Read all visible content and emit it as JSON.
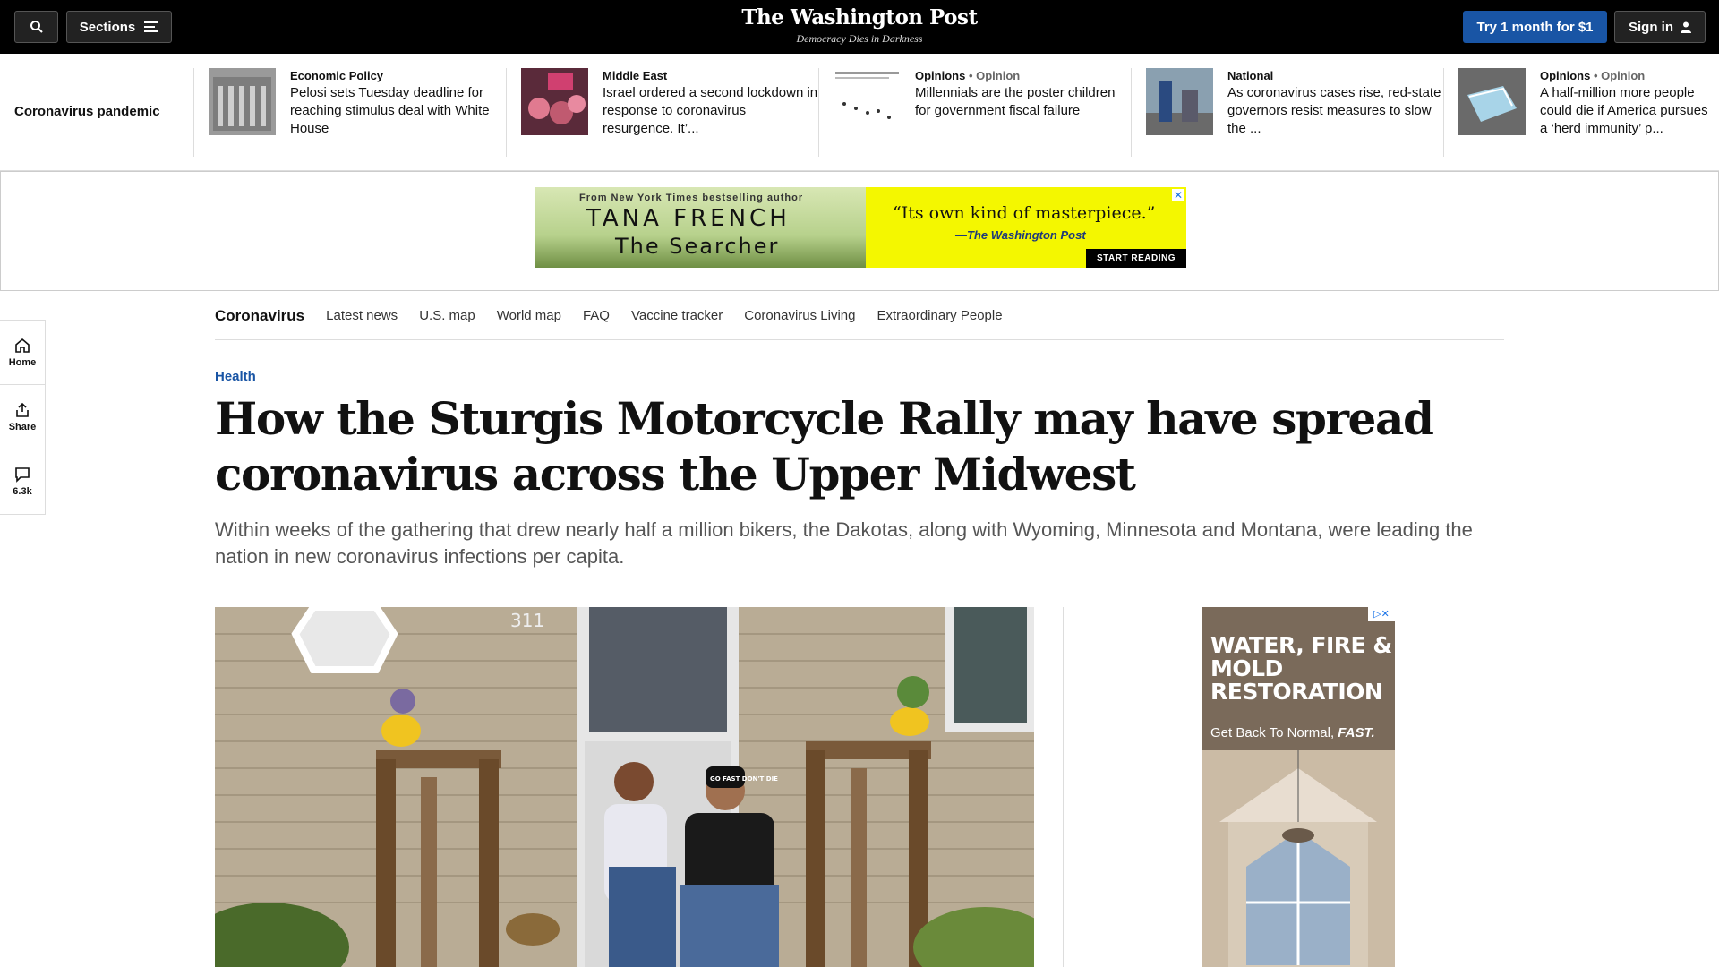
{
  "topbar": {
    "sections_label": "Sections",
    "logo": "The Washington Post",
    "tagline": "Democracy Dies in Darkness",
    "try_label": "Try 1 month for $1",
    "signin_label": "Sign in"
  },
  "strip": {
    "label": "Coronavirus pandemic",
    "items": [
      {
        "kicker": "Economic Policy",
        "opinion": "",
        "headline": "Pelosi sets Tuesday deadline for reaching stimulus deal with White House"
      },
      {
        "kicker": "Middle East",
        "opinion": "",
        "headline": "Israel ordered a second lockdown in response to coronavirus resurgence. It’..."
      },
      {
        "kicker": "Opinions",
        "opinion": "• Opinion",
        "headline": "Millennials are the poster children for government fiscal failure"
      },
      {
        "kicker": "National",
        "opinion": "",
        "headline": "As coronavirus cases rise, red-state governors resist measures to slow the ..."
      },
      {
        "kicker": "Opinions",
        "opinion": "• Opinion",
        "headline": "A half-million more people could die if America pursues a ‘herd immunity’ p..."
      }
    ]
  },
  "banner_ad": {
    "from": "From New York Times bestselling author",
    "author": "TANA FRENCH",
    "book": "The Searcher",
    "quote": "“Its own kind of masterpiece.”",
    "source": "—The Washington Post",
    "cta": "START READING"
  },
  "subnav": {
    "main": "Coronavirus",
    "links": [
      "Latest news",
      "U.S. map",
      "World map",
      "FAQ",
      "Vaccine tracker",
      "Coronavirus Living",
      "Extraordinary People"
    ]
  },
  "rail": {
    "home": "Home",
    "share": "Share",
    "comments": "6.3k"
  },
  "article": {
    "section": "Health",
    "headline": "How the Sturgis Motorcycle Rally may have spread coronavirus across the Upper Midwest",
    "dek": "Within weeks of the gathering that drew nearly half a million bikers, the Dakotas, along with Wyoming, Minnesota and Montana, were leading the nation in new coronavirus infections per capita.",
    "photo_house_number": "311",
    "photo_cap_text": "GO FAST DON'T DIE"
  },
  "side_ad": {
    "title": "WATER, FIRE & MOLD RESTORATION",
    "sub_plain": "Get Back To Normal,",
    "sub_em": "FAST."
  },
  "colors": {
    "accent": "#1955a5",
    "topbar": "#000000",
    "banner_yellow": "#f4f700"
  }
}
